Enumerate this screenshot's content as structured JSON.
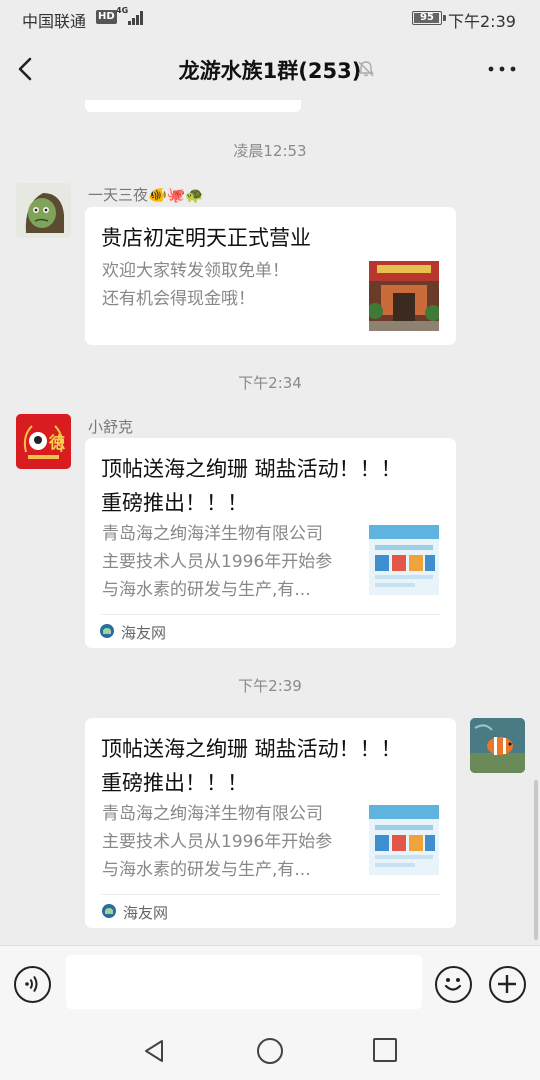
{
  "status_bar": {
    "carrier": "中国联通",
    "hd": "HD",
    "network": "4G",
    "battery": "95",
    "time": "下午2:39"
  },
  "header": {
    "title": "龙游水族1群(253)",
    "back_icon": "chevron-left-icon",
    "mute_icon": "bell-off-icon",
    "more_icon": "ellipsis-icon"
  },
  "messages": [
    {
      "timestamp": "凌晨12:53",
      "sender": "一天三夜🐠🐙🐢",
      "card": {
        "title": " 贵店初定明天正式营业",
        "desc_lines": [
          "欢迎大家转发领取免单！",
          "还有机会得现金哦！"
        ]
      }
    },
    {
      "timestamp": "下午2:34",
      "sender": "小舒克",
      "card": {
        "title_lines": [
          "顶帖送海之绚珊 瑚盐活动！！！",
          "重磅推出！！！"
        ],
        "desc_lines": [
          "青岛海之绚海洋生物有限公司",
          "主要技术人员从1996年开始参",
          "与海水素的研发与生产,有..."
        ],
        "source": "海友网"
      }
    },
    {
      "timestamp": "下午2:39",
      "card": {
        "title_lines": [
          "顶帖送海之绚珊 瑚盐活动！！！",
          "重磅推出！！！"
        ],
        "desc_lines": [
          "青岛海之绚海洋生物有限公司",
          "主要技术人员从1996年开始参",
          "与海水素的研发与生产,有..."
        ],
        "source": "海友网"
      }
    }
  ],
  "input": {
    "voice_icon": "voice-icon",
    "placeholder": "",
    "emoji_icon": "emoji-icon",
    "plus_icon": "plus-icon"
  },
  "nav": {
    "back_icon": "nav-back-icon",
    "home_icon": "nav-home-icon",
    "recent_icon": "nav-recent-icon"
  },
  "colors": {
    "background": "#ededed",
    "card": "#ffffff",
    "timestamp": "#8a8a8a"
  }
}
